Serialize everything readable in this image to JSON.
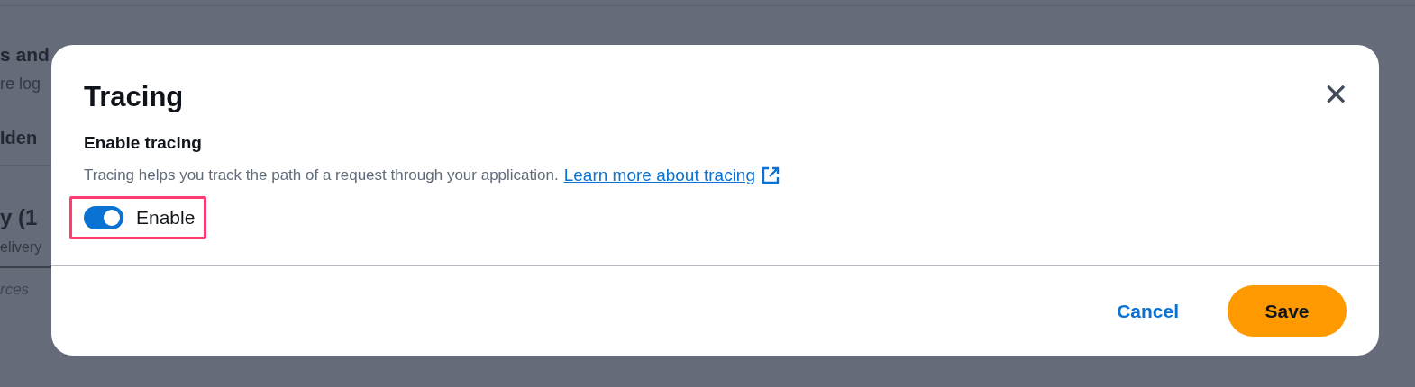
{
  "background": {
    "heading": "s and",
    "subtitle": "re log",
    "tab": "Iden",
    "section_title": "y (1",
    "section_subtitle": "elivery",
    "placeholder": "rces"
  },
  "dialog": {
    "title": "Tracing",
    "close_label": "✕",
    "field_label": "Enable tracing",
    "description": "Tracing helps you track the path of a request through your application.",
    "link": "Learn more about tracing",
    "toggle": {
      "label": "Enable",
      "on": true,
      "highlighted": true
    },
    "buttons": [
      {
        "label": "Cancel",
        "kind": "link"
      },
      {
        "label": "Save",
        "kind": "primary"
      }
    ]
  }
}
